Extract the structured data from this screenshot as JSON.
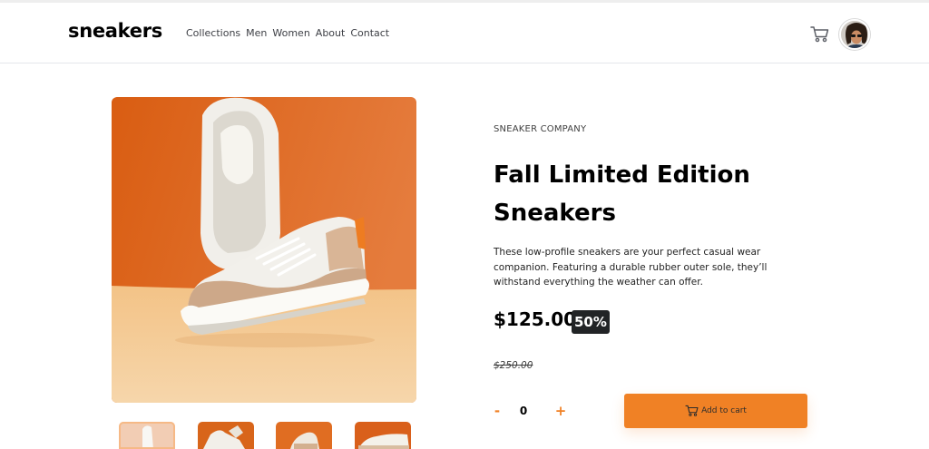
{
  "header": {
    "logo": "sneakers",
    "nav": [
      "Collections",
      "Men",
      "Women",
      "About",
      "Contact"
    ]
  },
  "product": {
    "company": "SNEAKER COMPANY",
    "title": "Fall Limited Edition Sneakers",
    "description": "These low-profile sneakers are your perfect casual wear companion. Featuring a durable rubber outer sole, they’ll withstand everything the weather can offer.",
    "price": "$125.00",
    "discount": "50%",
    "old_price": "$250.00"
  },
  "quantity": {
    "minus": "-",
    "value": "0",
    "plus": "+"
  },
  "add_to_cart": "Add to cart",
  "icons": {
    "cart": "cart-icon",
    "add_cart": "cart-icon"
  },
  "colors": {
    "accent": "#f08125",
    "photo_bg": "#e66f1f",
    "floor": "#f3c98d",
    "dark_badge": "#222426"
  }
}
